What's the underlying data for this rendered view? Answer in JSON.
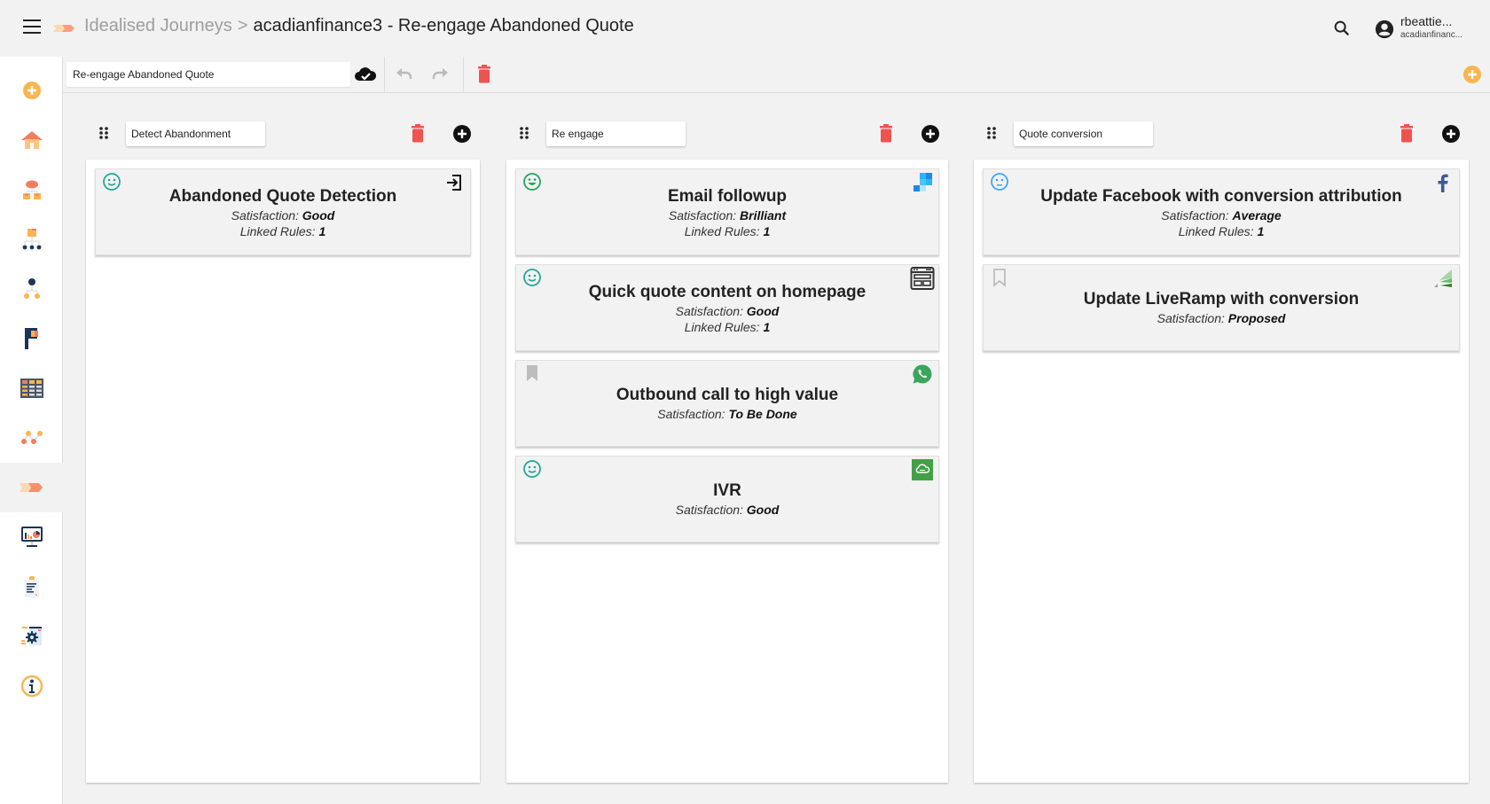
{
  "topbar": {
    "breadcrumb_parent": "Idealised Journeys",
    "breadcrumb_separator": ">",
    "breadcrumb_current": "acadianfinance3 - Re-engage Abandoned Quote",
    "user_name": "rbeattie...",
    "user_org": "acadianfinanc..."
  },
  "sidebar": {
    "items": [
      {
        "name": "add",
        "icon": "plus-circle-icon"
      },
      {
        "name": "home",
        "icon": "home-icon"
      },
      {
        "name": "cloud-hierarchy",
        "icon": "cloud-hierarchy-icon"
      },
      {
        "name": "folder-hierarchy",
        "icon": "folder-hierarchy-icon"
      },
      {
        "name": "org-chart",
        "icon": "org-chart-icon"
      },
      {
        "name": "flag",
        "icon": "flag-icon"
      },
      {
        "name": "table",
        "icon": "table-icon"
      },
      {
        "name": "graph",
        "icon": "graph-icon"
      },
      {
        "name": "journeys",
        "icon": "journey-arrow-icon",
        "active": true
      },
      {
        "name": "dashboard",
        "icon": "dashboard-icon"
      },
      {
        "name": "report",
        "icon": "report-icon"
      },
      {
        "name": "settings",
        "icon": "settings-icon"
      },
      {
        "name": "info",
        "icon": "info-icon"
      }
    ]
  },
  "toolbar": {
    "journey_name": "Re-engage Abandoned Quote"
  },
  "colors": {
    "accent_orange": "#f9b551",
    "delete_red": "#ef5350",
    "good_green": "#26a69a",
    "average_blue": "#42a5f5"
  },
  "stages": [
    {
      "name": "Detect Abandonment",
      "cards": [
        {
          "title": "Abandoned Quote Detection",
          "satisfaction_label": "Satisfaction:",
          "satisfaction": "Good",
          "rules_label": "Linked Rules:",
          "rules": "1",
          "status_icon": "smile-icon",
          "channel_icon": "login-icon"
        }
      ]
    },
    {
      "name": "Re engage",
      "cards": [
        {
          "title": "Email followup",
          "satisfaction_label": "Satisfaction:",
          "satisfaction": "Brilliant",
          "rules_label": "Linked Rules:",
          "rules": "1",
          "status_icon": "grin-icon",
          "channel_icon": "email-pixel-icon"
        },
        {
          "title": "Quick quote content on homepage",
          "satisfaction_label": "Satisfaction:",
          "satisfaction": "Good",
          "rules_label": "Linked Rules:",
          "rules": "1",
          "status_icon": "smile-icon",
          "channel_icon": "webpage-icon"
        },
        {
          "title": "Outbound call to high value",
          "satisfaction_label": "Satisfaction:",
          "satisfaction": "To Be Done",
          "status_icon": "bookmark-filled-icon",
          "channel_icon": "whatsapp-icon"
        },
        {
          "title": "IVR",
          "satisfaction_label": "Satisfaction:",
          "satisfaction": "Good",
          "status_icon": "smile-icon",
          "channel_icon": "ivr-cloud-icon"
        }
      ]
    },
    {
      "name": "Quote conversion",
      "cards": [
        {
          "title": "Update Facebook with conversion attribution",
          "satisfaction_label": "Satisfaction:",
          "satisfaction": "Average",
          "rules_label": "Linked Rules:",
          "rules": "1",
          "status_icon": "neutral-face-icon",
          "channel_icon": "facebook-icon"
        },
        {
          "title": "Update LiveRamp with conversion",
          "satisfaction_label": "Satisfaction:",
          "satisfaction": "Proposed",
          "status_icon": "bookmark-outline-icon",
          "channel_icon": "liveramp-icon"
        }
      ]
    }
  ]
}
